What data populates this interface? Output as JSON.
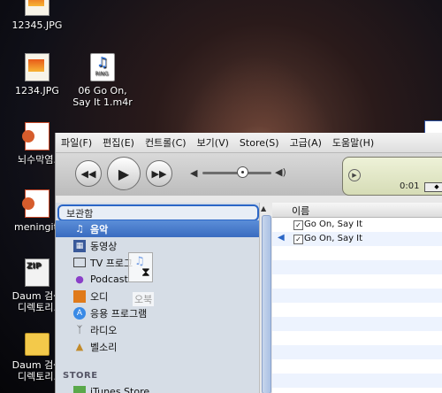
{
  "desktop": {
    "icons": [
      {
        "id": "jpg-12345",
        "label": "12345.JPG",
        "kind": "image"
      },
      {
        "id": "jpg-1234",
        "label": "1234.JPG",
        "kind": "image"
      },
      {
        "id": "m4r",
        "label": "06 Go On,\nSay It 1.m4r",
        "kind": "ringtone"
      },
      {
        "id": "ppt-1",
        "label": "뇌수막염.",
        "kind": "presentation"
      },
      {
        "id": "ppt-2",
        "label": "meningiti",
        "kind": "presentation"
      },
      {
        "id": "zip",
        "label": "Daum 검색\n디렉토리.",
        "kind": "zip"
      },
      {
        "id": "folder",
        "label": "Daum 검색\n디렉토리.",
        "kind": "folder"
      }
    ],
    "m4r_badge": "RING",
    "zip_badge": "ZIP"
  },
  "itunes": {
    "menu": [
      "파일(F)",
      "편집(E)",
      "컨트롤(C)",
      "보기(V)",
      "Store(S)",
      "고급(A)",
      "도움말(H)"
    ],
    "lcd": {
      "time": "0:01"
    },
    "sidebar": {
      "header": "보관함",
      "items": [
        {
          "label": "음악",
          "icon": "music-note-icon",
          "selected": true
        },
        {
          "label": "동영상",
          "icon": "film-icon",
          "selected": false
        },
        {
          "label": "TV 프로그",
          "icon": "tv-icon",
          "selected": false
        },
        {
          "label": "Podcast",
          "icon": "podcast-icon",
          "selected": false
        },
        {
          "label": "오디",
          "icon": "audiobook-icon",
          "selected": false
        },
        {
          "label": "응용 프로그램",
          "icon": "app-store-icon",
          "selected": false
        },
        {
          "label": "라디오",
          "icon": "radio-antenna-icon",
          "selected": false
        },
        {
          "label": "벨소리",
          "icon": "bell-icon",
          "selected": false
        }
      ],
      "store_heading": "STORE",
      "store_item": "iTunes Store"
    },
    "drag": {
      "label": "오북"
    },
    "tracks": {
      "column": "이름",
      "rows": [
        {
          "name": "Go On, Say It",
          "checked": true,
          "playing": false
        },
        {
          "name": "Go On, Say It",
          "checked": true,
          "playing": true
        }
      ]
    }
  }
}
